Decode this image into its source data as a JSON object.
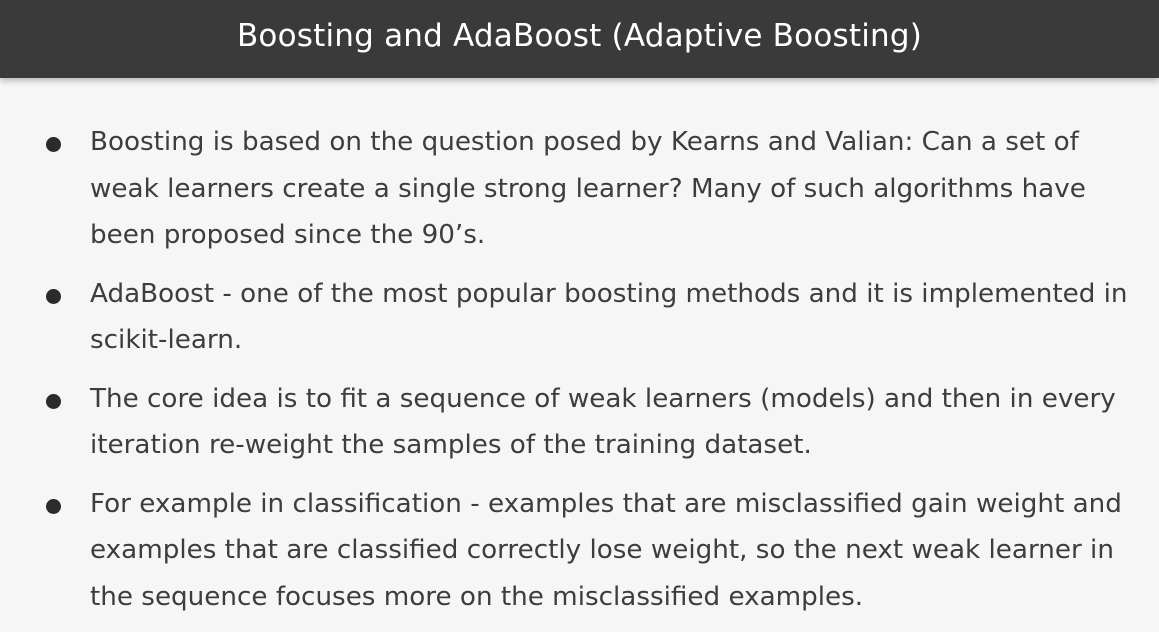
{
  "slide": {
    "title": "Boosting and AdaBoost (Adaptive Boosting)",
    "bullets": [
      {
        "text": "Boosting is based on the question posed by Kearns and Valian: Can a set of weak learners create a single strong learner? Many of such algorithms have been proposed since the 90’s."
      },
      {
        "text": "AdaBoost - one of the most popular boosting methods and it is implemented in scikit-learn."
      },
      {
        "text": "The core idea is to fit a sequence of weak learners (models) and then in every iteration re-weight the samples of the training dataset."
      },
      {
        "text": "For example in classification - examples that are misclassified gain weight and examples that are classified correctly lose weight, so the next weak learner in the sequence focuses more on the misclassified examples."
      }
    ]
  }
}
